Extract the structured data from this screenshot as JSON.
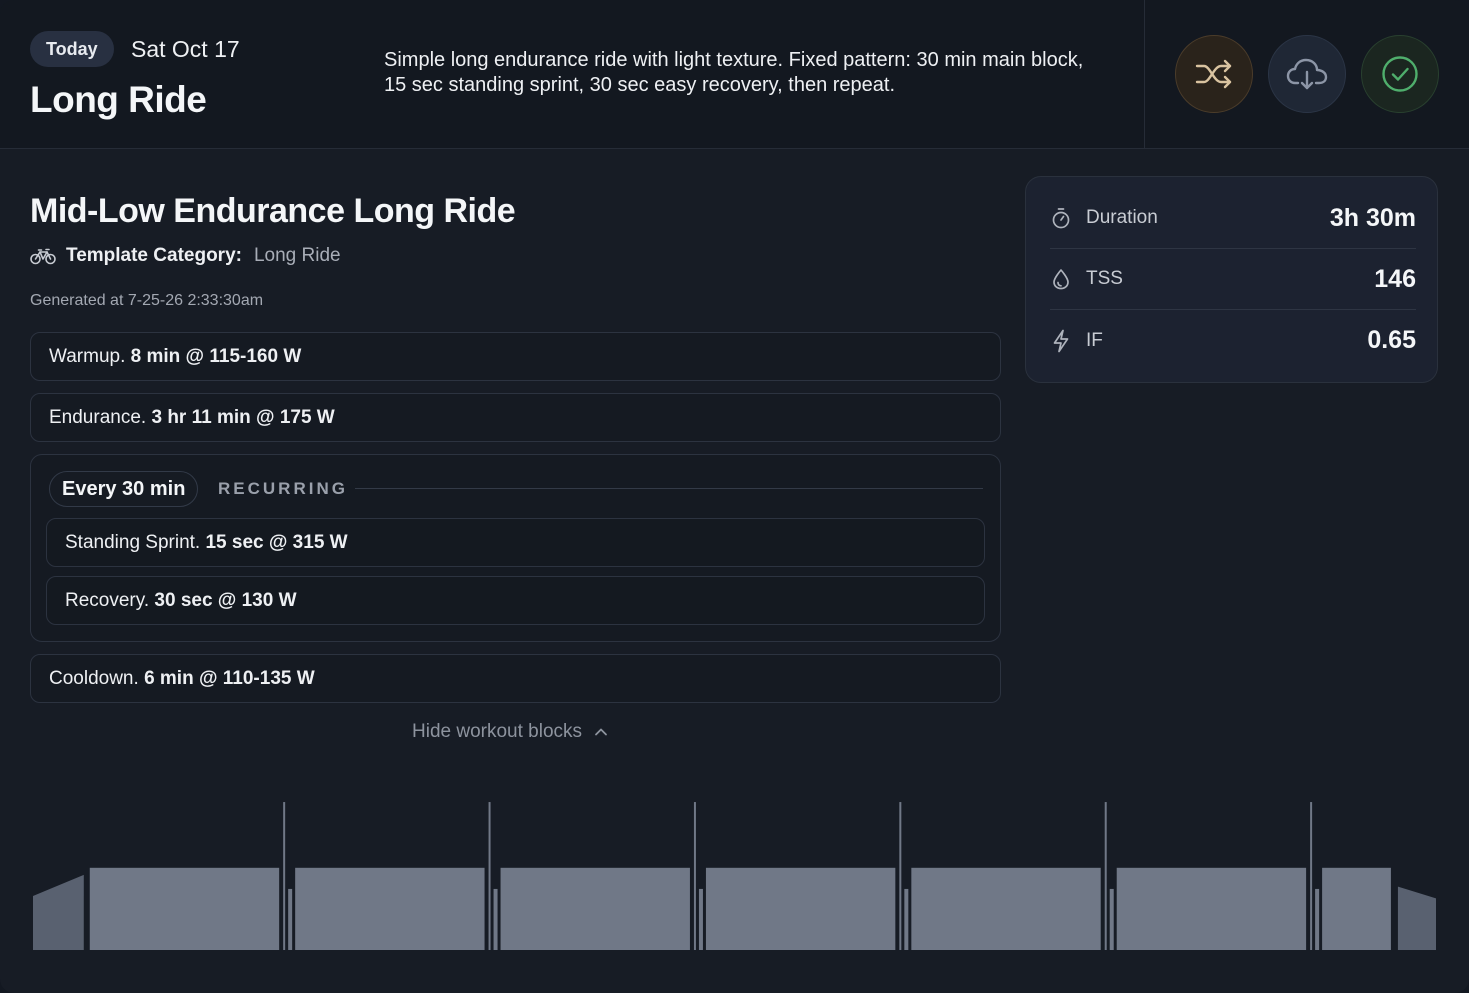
{
  "header": {
    "today_label": "Today",
    "date": "Sat Oct 17",
    "title": "Long Ride",
    "description": "Simple long endurance ride with light texture. Fixed pattern: 30 min main block, 15 sec standing sprint, 30 sec easy recovery, then repeat.",
    "actions": [
      {
        "name": "shuffle",
        "icon": "shuffle-icon",
        "color": "#d9c3a0"
      },
      {
        "name": "download",
        "icon": "cloud-download-icon",
        "color": "#8c95a6"
      },
      {
        "name": "complete",
        "icon": "check-circle-icon",
        "color": "#4fae6c"
      }
    ]
  },
  "workout": {
    "title": "Mid-Low Endurance Long Ride",
    "category_label": "Template Category:",
    "category_value": "Long Ride",
    "generated": "Generated at 7-25-26 2:33:30am"
  },
  "blocks": {
    "warmup": {
      "name": "Warmup.",
      "detail": "8 min @ 115-160 W"
    },
    "endurance": {
      "name": "Endurance.",
      "detail": "3 hr 11 min @ 175 W"
    },
    "recurring": {
      "every": "Every 30 min",
      "label": "RECURRING",
      "items": [
        {
          "name": "Standing Sprint.",
          "detail": "15 sec @ 315 W"
        },
        {
          "name": "Recovery.",
          "detail": "30 sec @ 130 W"
        }
      ]
    },
    "cooldown": {
      "name": "Cooldown.",
      "detail": "6 min @ 110-135 W"
    }
  },
  "toggle_label": "Hide workout blocks",
  "stats": {
    "duration": {
      "label": "Duration",
      "value": "3h 30m"
    },
    "tss": {
      "label": "TSS",
      "value": "146"
    },
    "if": {
      "label": "IF",
      "value": "0.65"
    }
  },
  "profile": {
    "bar_color": "#707887",
    "edge_color": "#596170",
    "segments": [
      {
        "type": "ramp",
        "minutes": 8,
        "from": 115,
        "to": 160
      },
      {
        "type": "steady",
        "minutes": 30,
        "watts": 175
      },
      {
        "type": "sprint",
        "seconds": 15,
        "watts": 315
      },
      {
        "type": "recovery",
        "seconds": 30,
        "watts": 130
      },
      {
        "type": "steady",
        "minutes": 30,
        "watts": 175
      },
      {
        "type": "sprint",
        "seconds": 15,
        "watts": 315
      },
      {
        "type": "recovery",
        "seconds": 30,
        "watts": 130
      },
      {
        "type": "steady",
        "minutes": 30,
        "watts": 175
      },
      {
        "type": "sprint",
        "seconds": 15,
        "watts": 315
      },
      {
        "type": "recovery",
        "seconds": 30,
        "watts": 130
      },
      {
        "type": "steady",
        "minutes": 30,
        "watts": 175
      },
      {
        "type": "sprint",
        "seconds": 15,
        "watts": 315
      },
      {
        "type": "recovery",
        "seconds": 30,
        "watts": 130
      },
      {
        "type": "steady",
        "minutes": 30,
        "watts": 175
      },
      {
        "type": "sprint",
        "seconds": 15,
        "watts": 315
      },
      {
        "type": "recovery",
        "seconds": 30,
        "watts": 130
      },
      {
        "type": "steady",
        "minutes": 30,
        "watts": 175
      },
      {
        "type": "sprint",
        "seconds": 15,
        "watts": 315
      },
      {
        "type": "recovery",
        "seconds": 30,
        "watts": 130
      },
      {
        "type": "steady",
        "minutes": 11,
        "watts": 175
      },
      {
        "type": "ramp",
        "minutes": 6,
        "from": 135,
        "to": 110
      }
    ]
  }
}
